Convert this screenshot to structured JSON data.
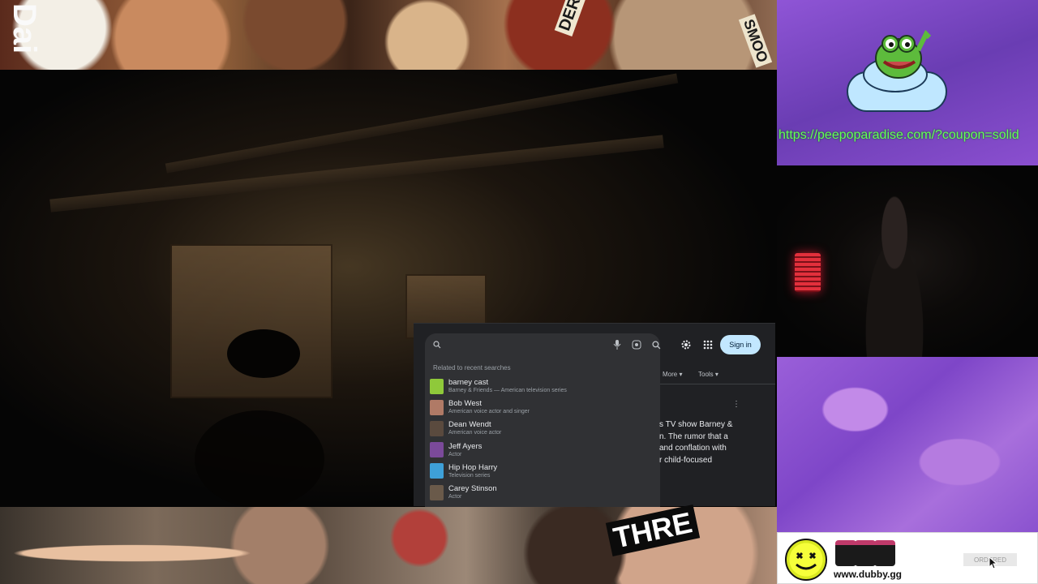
{
  "top_banner": {
    "brand_text": "Dai",
    "tag_text": "DER",
    "tag_text_2": "SMOO"
  },
  "search": {
    "query": "",
    "sign_in_label": "Sign in",
    "related_heading": "Related to recent searches",
    "suggestions": [
      {
        "title": "barney cast",
        "subtitle": "Barney & Friends — American television series",
        "thumb_color": "#8fc93a"
      },
      {
        "title": "Bob West",
        "subtitle": "American voice actor and singer",
        "thumb_color": "#b07a66"
      },
      {
        "title": "Dean Wendt",
        "subtitle": "American voice actor",
        "thumb_color": "#5a4a3e"
      },
      {
        "title": "Jeff Ayers",
        "subtitle": "Actor",
        "thumb_color": "#7b4a9a"
      },
      {
        "title": "Hip Hop Harry",
        "subtitle": "Television series",
        "thumb_color": "#3ea0d8"
      },
      {
        "title": "Carey Stinson",
        "subtitle": "Actor",
        "thumb_color": "#6a5a4a"
      }
    ],
    "tabs": {
      "more": "More ▾",
      "tools": "Tools ▾"
    },
    "snippet_lines": [
      "s TV show Barney &",
      "n. The rumor that a",
      "and conflation with",
      "r child-focused"
    ]
  },
  "bottom_banner": {
    "threat_text": "THRE"
  },
  "promo": {
    "url": "https://peepoparadise.com/?coupon=solid"
  },
  "sponsor": {
    "url": "www.dubby.gg",
    "ordered_label": "ORDERED",
    "tub_label": "DUBBY"
  },
  "colors": {
    "accent_green": "#64ff5a",
    "purple": "#8f55d6",
    "sign_in_bg": "#c2e7ff"
  }
}
